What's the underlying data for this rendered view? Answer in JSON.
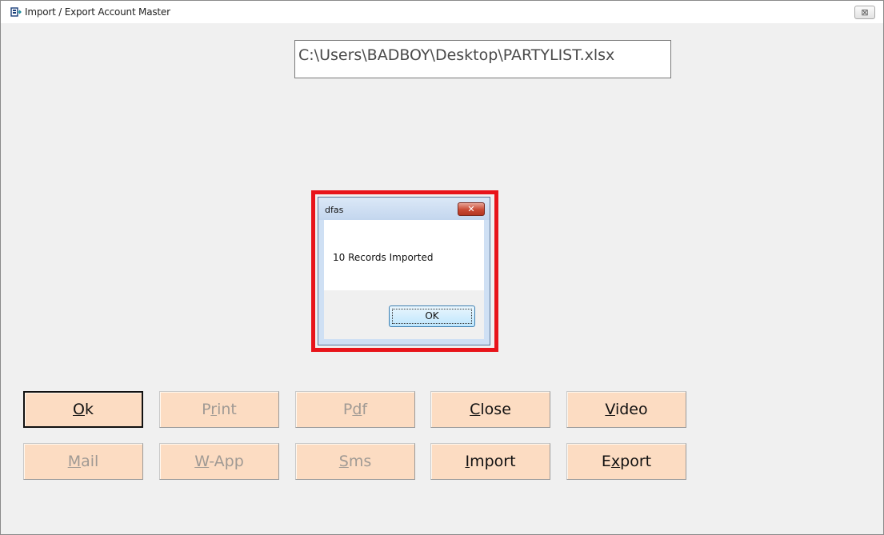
{
  "window": {
    "title": "Import / Export Account Master",
    "close_glyph": "⊠"
  },
  "file_path": "C:\\Users\\BADBOY\\Desktop\\PARTYLIST.xlsx",
  "dialog": {
    "title": "dfas",
    "message": "10 Records Imported",
    "ok_label": "OK",
    "close_glyph": "✕"
  },
  "buttons": {
    "ok": {
      "pre": "",
      "key": "O",
      "post": "k"
    },
    "print": {
      "pre": "P",
      "key": "r",
      "post": "int"
    },
    "pdf": {
      "pre": "P",
      "key": "d",
      "post": "f"
    },
    "close": {
      "pre": "",
      "key": "C",
      "post": "lose"
    },
    "video": {
      "pre": "",
      "key": "V",
      "post": "ideo"
    },
    "mail": {
      "pre": "",
      "key": "M",
      "post": "ail"
    },
    "wapp": {
      "pre": "",
      "key": "W",
      "post": "-App"
    },
    "sms": {
      "pre": "",
      "key": "S",
      "post": "ms"
    },
    "import": {
      "pre": "",
      "key": "I",
      "post": "mport"
    },
    "export": {
      "pre": "E",
      "key": "x",
      "post": "port"
    }
  },
  "colors": {
    "button_bg": "#fcdcc2",
    "highlight": "#e8141a",
    "disabled_text": "#a09a94"
  }
}
